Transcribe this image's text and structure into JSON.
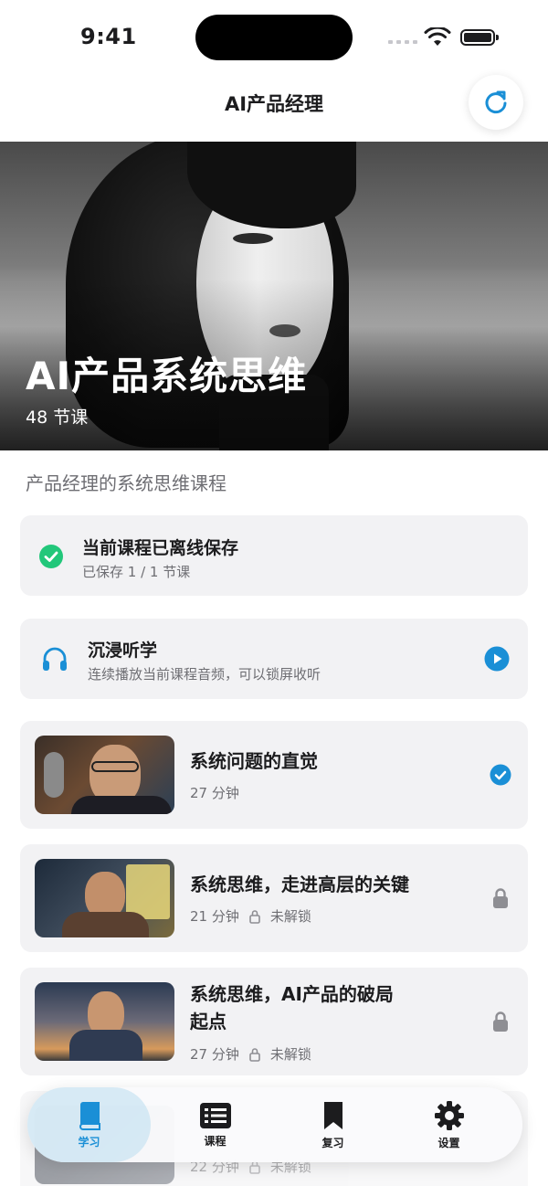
{
  "status_bar": {
    "time": "9:41"
  },
  "header": {
    "title": "AI产品经理"
  },
  "hero": {
    "title": "AI产品系统思维",
    "subtitle": "48 节课"
  },
  "description": "产品经理的系统思维课程",
  "offline_card": {
    "title": "当前课程已离线保存",
    "subtitle": "已保存 1 / 1 节课",
    "icon": "check-circle-icon"
  },
  "listen_card": {
    "title": "沉浸听学",
    "subtitle": "连续播放当前课程音频，可以锁屏收听",
    "icon": "headphones-icon"
  },
  "lessons": [
    {
      "title": "系统问题的直觉",
      "duration": "27 分钟",
      "lock_text": "",
      "status": "completed"
    },
    {
      "title": "系统思维，走进高层的关键",
      "duration": "21 分钟",
      "lock_text": "未解锁",
      "status": "locked"
    },
    {
      "title": "系统思维，AI产品的破局起点",
      "duration": "27 分钟",
      "lock_text": "未解锁",
      "status": "locked"
    },
    {
      "title": "",
      "duration": "22 分钟",
      "lock_text": "未解锁",
      "status": "locked"
    }
  ],
  "tabbar": {
    "tabs": [
      {
        "label": "学习",
        "icon": "book-icon",
        "active": true
      },
      {
        "label": "课程",
        "icon": "list-icon",
        "active": false
      },
      {
        "label": "复习",
        "icon": "bookmark-icon",
        "active": false
      },
      {
        "label": "设置",
        "icon": "gear-icon",
        "active": false
      }
    ]
  },
  "colors": {
    "accent": "#1a8fd6",
    "success": "#22c77a",
    "card_bg": "#f2f2f4",
    "muted": "#6e6e73"
  }
}
